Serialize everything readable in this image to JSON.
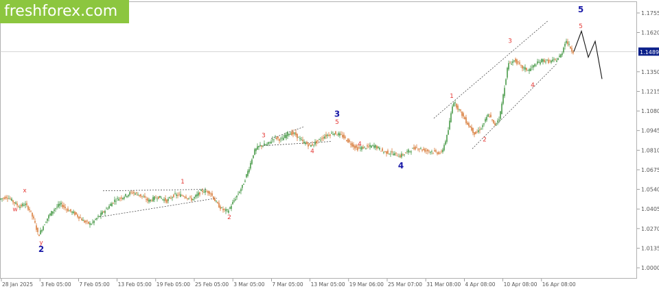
{
  "logo": {
    "text": "freshforex.com",
    "bg_color": "#8cc63f"
  },
  "colors": {
    "up": "#2e8b2e",
    "down": "#d2691e",
    "wave_red": "#e53935",
    "wave_blue": "#1a1aa8",
    "axis": "#555555"
  },
  "chart_data": {
    "type": "candlestick",
    "title": "",
    "xlabel": "",
    "ylabel": "",
    "current_price": "1.1489",
    "ylim": [
      0.9925,
      1.1835
    ],
    "y_ticks": [
      "1.1755",
      "1.1620",
      "1.1489",
      "1.1350",
      "1.1215",
      "1.1080",
      "1.0945",
      "1.0810",
      "1.0675",
      "1.0540",
      "1.0405",
      "1.0270",
      "1.0135",
      "1.0000"
    ],
    "x_ticks": [
      "28 Jan 2025",
      "3 Feb 05:00",
      "7 Feb 05:00",
      "13 Feb 05:00",
      "19 Feb 05:00",
      "25 Feb 05:00",
      "3 Mar 05:00",
      "7 Mar 05:00",
      "13 Mar 05:00",
      "19 Mar 06:00",
      "25 Mar 07:00",
      "31 Mar 08:00",
      "4 Apr 08:00",
      "10 Apr 08:00",
      "16 Apr 08:00"
    ],
    "price_path": [
      [
        0,
        1.047
      ],
      [
        12,
        1.049
      ],
      [
        20,
        1.046
      ],
      [
        30,
        1.042
      ],
      [
        38,
        1.044
      ],
      [
        45,
        1.04
      ],
      [
        52,
        1.032
      ],
      [
        58,
        1.022
      ],
      [
        64,
        1.028
      ],
      [
        72,
        1.035
      ],
      [
        80,
        1.04
      ],
      [
        90,
        1.044
      ],
      [
        100,
        1.04
      ],
      [
        112,
        1.037
      ],
      [
        124,
        1.032
      ],
      [
        134,
        1.03
      ],
      [
        145,
        1.035
      ],
      [
        158,
        1.041
      ],
      [
        170,
        1.047
      ],
      [
        182,
        1.049
      ],
      [
        194,
        1.052
      ],
      [
        206,
        1.05
      ],
      [
        218,
        1.046
      ],
      [
        232,
        1.049
      ],
      [
        245,
        1.046
      ],
      [
        255,
        1.05
      ],
      [
        268,
        1.05
      ],
      [
        282,
        1.047
      ],
      [
        296,
        1.053
      ],
      [
        308,
        1.052
      ],
      [
        318,
        1.044
      ],
      [
        326,
        1.04
      ],
      [
        334,
        1.039
      ],
      [
        345,
        1.048
      ],
      [
        355,
        1.056
      ],
      [
        365,
        1.069
      ],
      [
        372,
        1.08
      ],
      [
        380,
        1.084
      ],
      [
        392,
        1.085
      ],
      [
        402,
        1.09
      ],
      [
        412,
        1.088
      ],
      [
        422,
        1.093
      ],
      [
        432,
        1.092
      ],
      [
        442,
        1.087
      ],
      [
        454,
        1.084
      ],
      [
        464,
        1.087
      ],
      [
        476,
        1.091
      ],
      [
        488,
        1.093
      ],
      [
        500,
        1.091
      ],
      [
        512,
        1.086
      ],
      [
        522,
        1.082
      ],
      [
        534,
        1.083
      ],
      [
        548,
        1.084
      ],
      [
        560,
        1.08
      ],
      [
        572,
        1.079
      ],
      [
        585,
        1.077
      ],
      [
        596,
        1.08
      ],
      [
        608,
        1.083
      ],
      [
        620,
        1.081
      ],
      [
        632,
        1.08
      ],
      [
        645,
        1.079
      ],
      [
        654,
        1.092
      ],
      [
        662,
        1.115
      ],
      [
        672,
        1.108
      ],
      [
        682,
        1.1
      ],
      [
        694,
        1.092
      ],
      [
        704,
        1.097
      ],
      [
        714,
        1.106
      ],
      [
        722,
        1.098
      ],
      [
        730,
        1.104
      ],
      [
        736,
        1.122
      ],
      [
        742,
        1.14
      ],
      [
        752,
        1.143
      ],
      [
        762,
        1.138
      ],
      [
        772,
        1.136
      ],
      [
        782,
        1.14
      ],
      [
        792,
        1.143
      ],
      [
        802,
        1.142
      ],
      [
        812,
        1.143
      ],
      [
        820,
        1.147
      ],
      [
        826,
        1.157
      ],
      [
        836,
        1.149
      ]
    ],
    "forecast_path": [
      [
        836,
        1.149
      ],
      [
        847,
        1.163
      ],
      [
        857,
        1.145
      ],
      [
        867,
        1.156
      ],
      [
        877,
        1.13
      ]
    ],
    "trend_lines": [
      [
        [
          145,
          1.035
        ],
        [
          316,
          1.048
        ]
      ],
      [
        [
          150,
          1.053
        ],
        [
          300,
          1.054
        ]
      ],
      [
        [
          380,
          1.084
        ],
        [
          482,
          1.087
        ]
      ],
      [
        [
          395,
          1.089
        ],
        [
          442,
          1.097
        ]
      ],
      [
        [
          632,
          1.103
        ],
        [
          798,
          1.17
        ]
      ],
      [
        [
          688,
          1.082
        ],
        [
          812,
          1.141
        ]
      ]
    ],
    "wave_labels": [
      {
        "text": "x",
        "x": 36,
        "price": 1.052,
        "color": "red"
      },
      {
        "text": "w",
        "x": 22,
        "price": 1.039,
        "color": "red"
      },
      {
        "text": "y",
        "x": 60,
        "price": 1.016,
        "color": "red"
      },
      {
        "text": "2",
        "x": 60,
        "price": 1.011,
        "color": "blue",
        "big": true
      },
      {
        "text": "1",
        "x": 266,
        "price": 1.058,
        "color": "red"
      },
      {
        "text": "2",
        "x": 334,
        "price": 1.0335,
        "color": "red"
      },
      {
        "text": "3",
        "x": 384,
        "price": 1.09,
        "color": "red"
      },
      {
        "text": "4",
        "x": 455,
        "price": 1.079,
        "color": "red"
      },
      {
        "text": "3",
        "x": 491,
        "price": 1.104,
        "color": "blue",
        "big": true
      },
      {
        "text": "5",
        "x": 491,
        "price": 1.099,
        "color": "red"
      },
      {
        "text": "4",
        "x": 524,
        "price": 1.084,
        "color": "red"
      },
      {
        "text": "4",
        "x": 584,
        "price": 1.0685,
        "color": "blue",
        "big": true
      },
      {
        "text": "1",
        "x": 658,
        "price": 1.117,
        "color": "red"
      },
      {
        "text": "2",
        "x": 706,
        "price": 1.087,
        "color": "red"
      },
      {
        "text": "3",
        "x": 743,
        "price": 1.155,
        "color": "red"
      },
      {
        "text": "4",
        "x": 776,
        "price": 1.1245,
        "color": "red"
      },
      {
        "text": "5",
        "x": 846,
        "price": 1.176,
        "color": "blue",
        "big": true
      },
      {
        "text": "5",
        "x": 846,
        "price": 1.165,
        "color": "red"
      }
    ]
  }
}
